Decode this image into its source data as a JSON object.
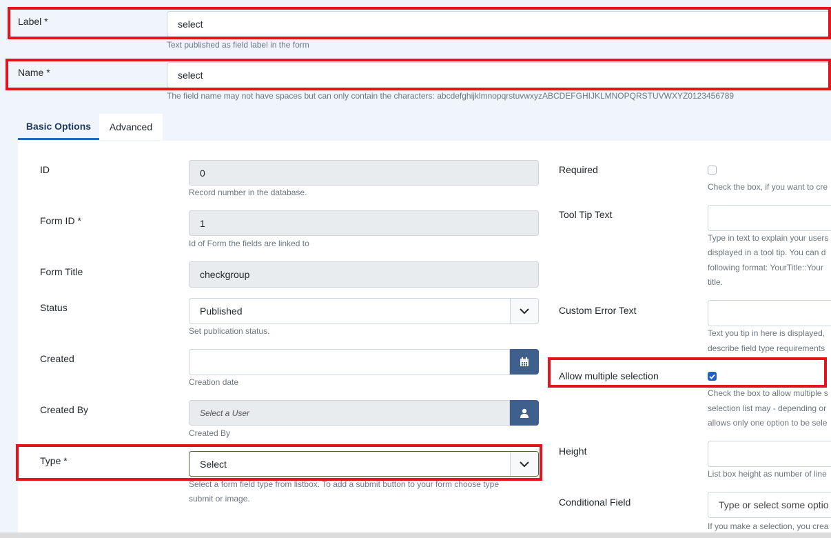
{
  "top_fields": {
    "label": {
      "label": "Label *",
      "value": "select",
      "help": "Text published as field label in the form"
    },
    "name": {
      "label": "Name *",
      "value": "select",
      "help": "The field name may not have spaces but can only contain the characters: abcdefghijklmnopqrstuvwxyzABCDEFGHIJKLMNOPQRSTUVWXYZ0123456789"
    }
  },
  "tabs": [
    {
      "label": "Basic Options",
      "active": true
    },
    {
      "label": "Advanced",
      "active": false
    }
  ],
  "left": {
    "id": {
      "label": "ID",
      "value": "0",
      "help": "Record number in the database."
    },
    "form_id": {
      "label": "Form ID *",
      "value": "1",
      "help": "Id of Form the fields are linked to"
    },
    "form_title": {
      "label": "Form Title",
      "value": "checkgroup"
    },
    "status": {
      "label": "Status",
      "value": "Published",
      "help": "Set publication status."
    },
    "created": {
      "label": "Created",
      "value": "",
      "help": "Creation date"
    },
    "created_by": {
      "label": "Created By",
      "placeholder": "Select a User",
      "help": "Created By"
    },
    "type": {
      "label": "Type *",
      "value": "Select",
      "help_line1": "Select a form field type from listbox. To add a submit button to your form choose type",
      "help_line2": "submit or image."
    }
  },
  "right": {
    "required": {
      "label": "Required",
      "checked": false,
      "help": "Check the box, if you want to cre"
    },
    "tooltip": {
      "label": "Tool Tip Text",
      "value": "",
      "help_lines": [
        "Type in text to explain your users",
        "displayed in a tool tip. You can d",
        "following format: YourTitle::Your",
        "title."
      ]
    },
    "custom_error": {
      "label": "Custom Error Text",
      "value": "",
      "help_lines": [
        "Text you tip in here is displayed,",
        "describe field type requirements"
      ]
    },
    "multiple": {
      "label": "Allow multiple selection",
      "checked": true,
      "help_lines": [
        "Check the box to allow multiple s",
        "selection list may - depending or",
        "allows only one option to be sele"
      ]
    },
    "height": {
      "label": "Height",
      "value": "",
      "help": "List box height as number of line"
    },
    "conditional": {
      "label": "Conditional Field",
      "placeholder": "Type or select some optio",
      "help": "If you make a selection, you crea"
    }
  },
  "colors": {
    "highlight": "#e3141c",
    "addon": "#3f5f8c",
    "checkbox": "#1e63c5",
    "tab_active": "#2a69b8"
  },
  "icons": {
    "chevron": "chevron-down-icon",
    "calendar": "calendar-icon",
    "user": "user-icon",
    "check": "check-icon"
  }
}
